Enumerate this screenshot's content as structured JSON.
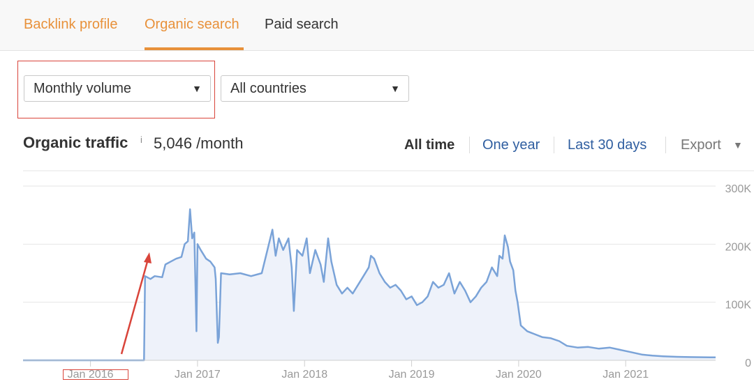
{
  "tabs": [
    {
      "label": "Backlink profile",
      "active": false
    },
    {
      "label": "Organic search",
      "active": true
    },
    {
      "label": "Paid search",
      "active": false
    }
  ],
  "filters": {
    "volume": "Monthly volume",
    "country": "All countries"
  },
  "traffic": {
    "title": "Organic traffic",
    "info": "i",
    "value": "5,046 /month"
  },
  "ranges": {
    "all_time": "All time",
    "one_year": "One year",
    "last_30_days": "Last 30 days",
    "export": "Export"
  },
  "colors": {
    "accent": "#e8913a",
    "link": "#2f5ea0",
    "line": "#7aa3d8",
    "area": "#eef2fa",
    "annotation": "#d9443a"
  },
  "chart_data": {
    "type": "area",
    "y_ticks": [
      {
        "value": 0,
        "label": "0"
      },
      {
        "value": 100000,
        "label": "100K"
      },
      {
        "value": 200000,
        "label": "200K"
      },
      {
        "value": 300000,
        "label": "300K"
      }
    ],
    "x_ticks": [
      {
        "x": 2016.0,
        "label": "Jan 2016"
      },
      {
        "x": 2017.0,
        "label": "Jan 2017"
      },
      {
        "x": 2018.0,
        "label": "Jan 2018"
      },
      {
        "x": 2019.0,
        "label": "Jan 2019"
      },
      {
        "x": 2020.0,
        "label": "Jan 2020"
      },
      {
        "x": 2021.0,
        "label": "Jan 2021"
      }
    ],
    "xlim": [
      2015.37,
      2021.84
    ],
    "ylim": [
      0,
      300000
    ],
    "grid": true,
    "points": [
      [
        2015.37,
        0
      ],
      [
        2016.2,
        0
      ],
      [
        2016.5,
        0
      ],
      [
        2016.51,
        145000
      ],
      [
        2016.56,
        140000
      ],
      [
        2016.6,
        145000
      ],
      [
        2016.67,
        143000
      ],
      [
        2016.7,
        165000
      ],
      [
        2016.75,
        170000
      ],
      [
        2016.8,
        175000
      ],
      [
        2016.85,
        178000
      ],
      [
        2016.88,
        200000
      ],
      [
        2016.91,
        205000
      ],
      [
        2016.93,
        260000
      ],
      [
        2016.95,
        210000
      ],
      [
        2016.97,
        220000
      ],
      [
        2016.99,
        50000
      ],
      [
        2017.0,
        200000
      ],
      [
        2017.03,
        190000
      ],
      [
        2017.08,
        175000
      ],
      [
        2017.12,
        170000
      ],
      [
        2017.16,
        160000
      ],
      [
        2017.17,
        140000
      ],
      [
        2017.19,
        30000
      ],
      [
        2017.2,
        40000
      ],
      [
        2017.22,
        150000
      ],
      [
        2017.3,
        148000
      ],
      [
        2017.4,
        150000
      ],
      [
        2017.5,
        145000
      ],
      [
        2017.6,
        150000
      ],
      [
        2017.7,
        225000
      ],
      [
        2017.73,
        180000
      ],
      [
        2017.76,
        210000
      ],
      [
        2017.8,
        190000
      ],
      [
        2017.85,
        210000
      ],
      [
        2017.88,
        160000
      ],
      [
        2017.9,
        85000
      ],
      [
        2017.93,
        190000
      ],
      [
        2017.98,
        180000
      ],
      [
        2018.02,
        210000
      ],
      [
        2018.05,
        150000
      ],
      [
        2018.1,
        190000
      ],
      [
        2018.15,
        165000
      ],
      [
        2018.18,
        135000
      ],
      [
        2018.22,
        210000
      ],
      [
        2018.25,
        170000
      ],
      [
        2018.3,
        130000
      ],
      [
        2018.35,
        115000
      ],
      [
        2018.4,
        125000
      ],
      [
        2018.45,
        115000
      ],
      [
        2018.5,
        130000
      ],
      [
        2018.55,
        145000
      ],
      [
        2018.6,
        160000
      ],
      [
        2018.62,
        180000
      ],
      [
        2018.65,
        175000
      ],
      [
        2018.7,
        150000
      ],
      [
        2018.75,
        135000
      ],
      [
        2018.8,
        125000
      ],
      [
        2018.85,
        130000
      ],
      [
        2018.9,
        120000
      ],
      [
        2018.95,
        105000
      ],
      [
        2019.0,
        110000
      ],
      [
        2019.05,
        95000
      ],
      [
        2019.1,
        100000
      ],
      [
        2019.15,
        110000
      ],
      [
        2019.2,
        135000
      ],
      [
        2019.25,
        125000
      ],
      [
        2019.3,
        130000
      ],
      [
        2019.35,
        150000
      ],
      [
        2019.4,
        115000
      ],
      [
        2019.45,
        135000
      ],
      [
        2019.5,
        120000
      ],
      [
        2019.55,
        100000
      ],
      [
        2019.6,
        110000
      ],
      [
        2019.65,
        125000
      ],
      [
        2019.7,
        135000
      ],
      [
        2019.75,
        160000
      ],
      [
        2019.8,
        145000
      ],
      [
        2019.82,
        180000
      ],
      [
        2019.85,
        175000
      ],
      [
        2019.87,
        215000
      ],
      [
        2019.9,
        195000
      ],
      [
        2019.92,
        170000
      ],
      [
        2019.95,
        155000
      ],
      [
        2019.97,
        120000
      ],
      [
        2019.99,
        100000
      ],
      [
        2020.02,
        60000
      ],
      [
        2020.08,
        50000
      ],
      [
        2020.15,
        45000
      ],
      [
        2020.22,
        40000
      ],
      [
        2020.3,
        38000
      ],
      [
        2020.38,
        33000
      ],
      [
        2020.45,
        25000
      ],
      [
        2020.55,
        22000
      ],
      [
        2020.65,
        23000
      ],
      [
        2020.75,
        20000
      ],
      [
        2020.85,
        22000
      ],
      [
        2020.95,
        18000
      ],
      [
        2021.05,
        14000
      ],
      [
        2021.15,
        10000
      ],
      [
        2021.25,
        8000
      ],
      [
        2021.35,
        7000
      ],
      [
        2021.48,
        6000
      ],
      [
        2021.6,
        5500
      ],
      [
        2021.84,
        5046
      ]
    ]
  }
}
